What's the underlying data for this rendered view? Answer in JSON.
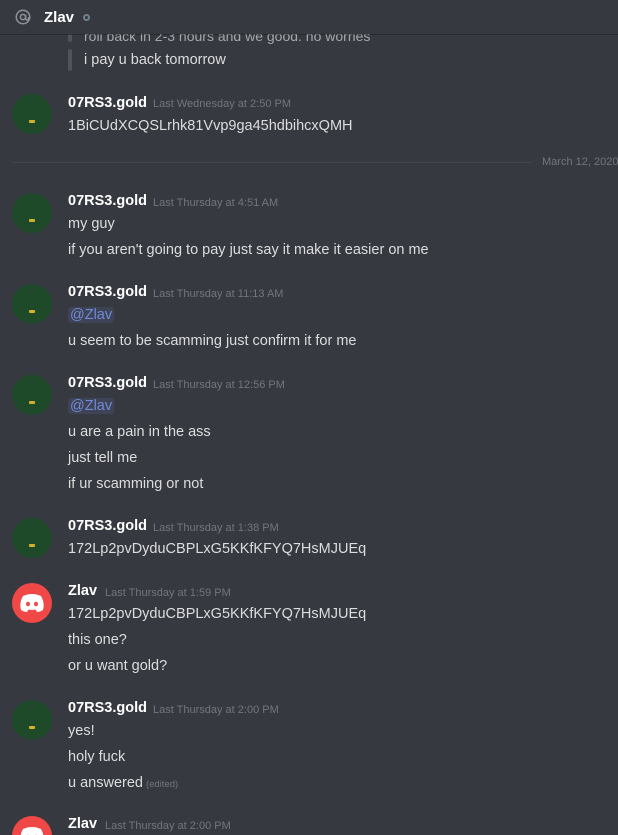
{
  "header": {
    "title": "Zlav"
  },
  "cutoff_text": "roll back in 2-3 hours and we good. no worries",
  "prev_line": "i pay u back tomorrow",
  "date_divider": "March 12, 2020",
  "messages": [
    {
      "author": "07RS3.gold",
      "timestamp": "Last Wednesday at 2:50 PM",
      "lines": [
        "1BiCUdXCQSLrhk81Vvp9ga45hdbihcxQMH"
      ]
    },
    {
      "author": "07RS3.gold",
      "timestamp": "Last Thursday at 4:51 AM",
      "lines": [
        "my guy",
        "if you aren't going to pay just say it make it easier on me"
      ]
    },
    {
      "author": "07RS3.gold",
      "timestamp": "Last Thursday at 11:13 AM",
      "mention": "@Zlav",
      "lines": [
        "u seem to be scamming just confirm it for me"
      ]
    },
    {
      "author": "07RS3.gold",
      "timestamp": "Last Thursday at 12:56 PM",
      "mention": "@Zlav",
      "lines": [
        "u are a pain in the ass",
        "just tell me",
        "if ur scamming or not"
      ]
    },
    {
      "author": "07RS3.gold",
      "timestamp": "Last Thursday at 1:38 PM",
      "lines": [
        "172Lp2pvDyduCBPLxG5KKfKFYQ7HsMJUEq"
      ]
    },
    {
      "author": "Zlav",
      "timestamp": "Last Thursday at 1:59 PM",
      "lines": [
        "172Lp2pvDyduCBPLxG5KKfKFYQ7HsMJUEq",
        "this one?",
        "or u want gold?"
      ]
    },
    {
      "author": "07RS3.gold",
      "timestamp": "Last Thursday at 2:00 PM",
      "lines": [
        "yes!",
        "holy fuck",
        "u answered"
      ],
      "edited_label": "(edited)"
    },
    {
      "author": "Zlav",
      "timestamp": "Last Thursday at 2:00 PM",
      "lines": []
    }
  ],
  "icons": {
    "header": "at-sign-icon",
    "discord_avatar": "discord-logo-icon"
  }
}
